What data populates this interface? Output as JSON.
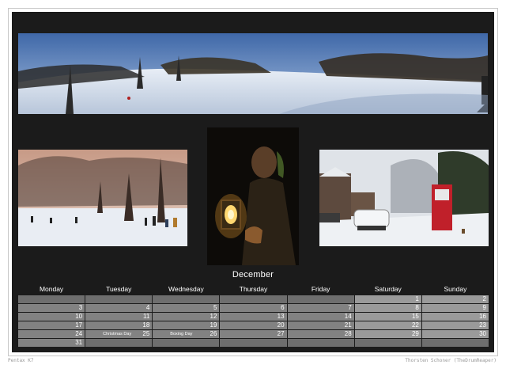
{
  "calendar": {
    "month": "December",
    "weekdays": [
      "Monday",
      "Tuesday",
      "Wednesday",
      "Thursday",
      "Friday",
      "Saturday",
      "Sunday"
    ],
    "weeks": [
      [
        {
          "day": ""
        },
        {
          "day": ""
        },
        {
          "day": ""
        },
        {
          "day": ""
        },
        {
          "day": ""
        },
        {
          "day": "1"
        },
        {
          "day": "2"
        }
      ],
      [
        {
          "day": "3"
        },
        {
          "day": "4"
        },
        {
          "day": "5"
        },
        {
          "day": "6"
        },
        {
          "day": "7"
        },
        {
          "day": "8"
        },
        {
          "day": "9"
        }
      ],
      [
        {
          "day": "10"
        },
        {
          "day": "11"
        },
        {
          "day": "12"
        },
        {
          "day": "13"
        },
        {
          "day": "14"
        },
        {
          "day": "15"
        },
        {
          "day": "16"
        }
      ],
      [
        {
          "day": "17"
        },
        {
          "day": "18"
        },
        {
          "day": "19"
        },
        {
          "day": "20"
        },
        {
          "day": "21"
        },
        {
          "day": "22"
        },
        {
          "day": "23"
        }
      ],
      [
        {
          "day": "24"
        },
        {
          "day": "25",
          "event": "Christmas Day"
        },
        {
          "day": "26",
          "event": "Boxing Day"
        },
        {
          "day": "27"
        },
        {
          "day": "28"
        },
        {
          "day": "29"
        },
        {
          "day": "30"
        }
      ],
      [
        {
          "day": "31"
        },
        {
          "day": ""
        },
        {
          "day": ""
        },
        {
          "day": ""
        },
        {
          "day": ""
        },
        {
          "day": ""
        },
        {
          "day": ""
        }
      ]
    ]
  },
  "footer": {
    "left": "Pentax K7",
    "right": "Thorsten Schoner (TheDrumReaper)"
  },
  "colors": {
    "panel": "#1b1b1b",
    "weekday_cell": "#828282",
    "weekend_cell": "#9a9a9a"
  }
}
